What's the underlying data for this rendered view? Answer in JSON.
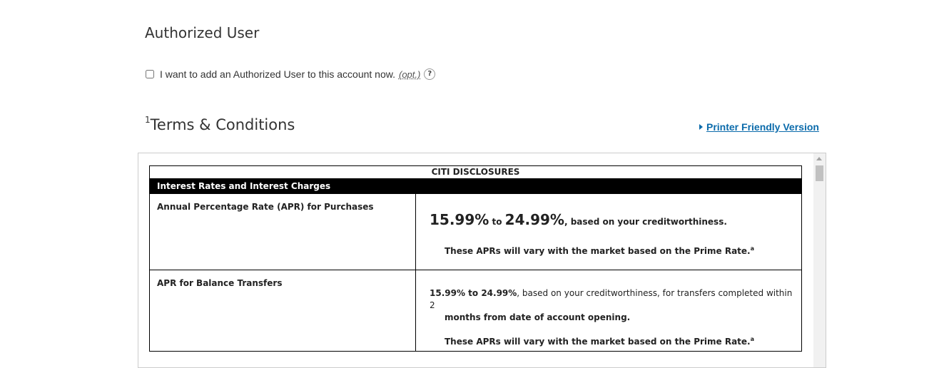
{
  "authorized_user": {
    "title": "Authorized User",
    "checkbox_label": "I want to add an Authorized User to this account now.",
    "opt_label": "(opt.)",
    "help_glyph": "?"
  },
  "terms": {
    "footnote": "1",
    "title": "Terms & Conditions",
    "printer_link": "Printer Friendly Version"
  },
  "disclosures": {
    "caption": "CITI DISCLOSURES",
    "section_header": "Interest Rates and Interest Charges",
    "rows": [
      {
        "label": "Annual Percentage Rate (APR) for Purchases",
        "rate_low": "15.99%",
        "rate_to": "to",
        "rate_high": "24.99%",
        "rate_suffix": ", based on your creditworthiness.",
        "note": "These APRs will vary with the market based on the Prime Rate.",
        "note_sup": "a"
      },
      {
        "label": "APR for Balance Transfers",
        "rate_text": "15.99% to 24.99%",
        "rate_suffix_1": ", based on your creditworthiness, for transfers completed within 2",
        "rate_suffix_2": "months from date of account opening.",
        "note": "These APRs will vary with the market based on the Prime Rate.",
        "note_sup": "a"
      }
    ]
  }
}
